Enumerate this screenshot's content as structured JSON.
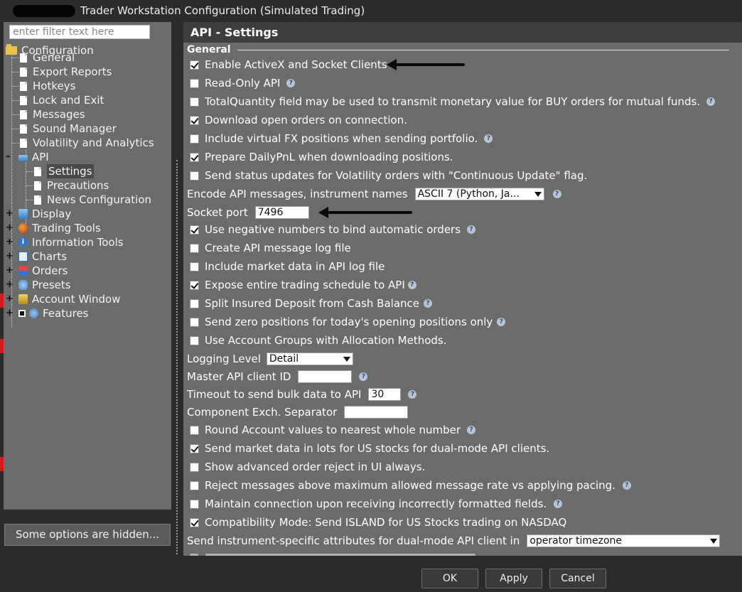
{
  "window": {
    "title": "Trader Workstation Configuration (Simulated Trading)"
  },
  "sidebar": {
    "filter_placeholder": "enter filter text here",
    "root_label": "Configuration",
    "items": [
      {
        "label": "General",
        "icon": "document-icon"
      },
      {
        "label": "Export Reports",
        "icon": "document-icon"
      },
      {
        "label": "Hotkeys",
        "icon": "document-icon"
      },
      {
        "label": "Lock and Exit",
        "icon": "document-icon"
      },
      {
        "label": "Messages",
        "icon": "document-icon"
      },
      {
        "label": "Sound Manager",
        "icon": "document-icon"
      },
      {
        "label": "Volatility and Analytics",
        "icon": "document-icon"
      },
      {
        "label": "API",
        "icon": "api-icon"
      },
      {
        "label": "Settings",
        "icon": "document-icon",
        "selected": true
      },
      {
        "label": "Precautions",
        "icon": "document-icon"
      },
      {
        "label": "News Configuration",
        "icon": "document-icon"
      },
      {
        "label": "Display",
        "icon": "display-icon"
      },
      {
        "label": "Trading Tools",
        "icon": "trading-tools-icon"
      },
      {
        "label": "Information Tools",
        "icon": "info-icon"
      },
      {
        "label": "Charts",
        "icon": "chart-icon"
      },
      {
        "label": "Orders",
        "icon": "orders-icon"
      },
      {
        "label": "Presets",
        "icon": "presets-icon"
      },
      {
        "label": "Account Window",
        "icon": "account-icon"
      },
      {
        "label": "Features",
        "icon": "features-icon"
      }
    ],
    "hidden_options_label": "Some options are hidden..."
  },
  "main": {
    "header": "API - Settings",
    "section": "General",
    "options": [
      {
        "label": "Enable ActiveX and Socket Clients",
        "checked": true,
        "help": false
      },
      {
        "label": "Read-Only API",
        "checked": false,
        "help": true
      },
      {
        "label": "TotalQuantity field may be used to transmit monetary value for BUY orders for mutual funds.",
        "checked": false,
        "help": true
      },
      {
        "label": "Download open orders on connection.",
        "checked": true,
        "help": false
      },
      {
        "label": "Include virtual FX positions when sending portfolio.",
        "checked": false,
        "help": true
      },
      {
        "label": "Prepare DailyPnL when downloading positions.",
        "checked": true,
        "help": false
      },
      {
        "label": "Send status updates for Volatility orders with \"Continuous Update\" flag.",
        "checked": false,
        "help": false
      }
    ],
    "encode_label": "Encode API messages, instrument names",
    "encode_value": "ASCII 7 (Python, Ja...",
    "socket_port_label": "Socket port",
    "socket_port_value": "7496",
    "options2": [
      {
        "label": "Use negative numbers to bind automatic orders",
        "checked": true,
        "help": true
      },
      {
        "label": "Create API message log file",
        "checked": false,
        "help": false
      },
      {
        "label": "Include market data in API log file",
        "checked": false,
        "help": false
      },
      {
        "label": "Expose entire trading schedule to API",
        "checked": true,
        "help": true
      },
      {
        "label": "Split Insured Deposit from Cash Balance",
        "checked": false,
        "help": true
      },
      {
        "label": "Send zero positions for today's opening positions only",
        "checked": false,
        "help": true
      },
      {
        "label": "Use Account Groups with Allocation Methods.",
        "checked": false,
        "help": false
      }
    ],
    "logging_level_label": "Logging Level",
    "logging_level_value": "Detail",
    "master_client_label": "Master API client ID",
    "master_client_value": "",
    "timeout_label": "Timeout to send bulk data to API",
    "timeout_value": "30",
    "component_sep_label": "Component Exch. Separator",
    "component_sep_value": "",
    "options3": [
      {
        "label": "Round Account values to nearest whole number",
        "checked": false,
        "help": true
      },
      {
        "label": "Send market data in lots for US stocks for dual-mode API clients.",
        "checked": true,
        "help": false
      },
      {
        "label": "Show advanced order reject in UI always.",
        "checked": false,
        "help": false
      },
      {
        "label": "Reject messages above maximum allowed message rate vs applying pacing.",
        "checked": false,
        "help": true
      },
      {
        "label": "Maintain connection upon receiving incorrectly formatted fields.",
        "checked": false,
        "help": true
      },
      {
        "label": "Compatibility Mode: Send ISLAND for US Stocks trading on NASDAQ",
        "checked": true,
        "help": false
      }
    ],
    "instrument_attr_label": "Send instrument-specific attributes for dual-mode API client in",
    "instrument_attr_value": "operator timezone"
  },
  "footer": {
    "ok": "OK",
    "apply": "Apply",
    "cancel": "Cancel"
  }
}
